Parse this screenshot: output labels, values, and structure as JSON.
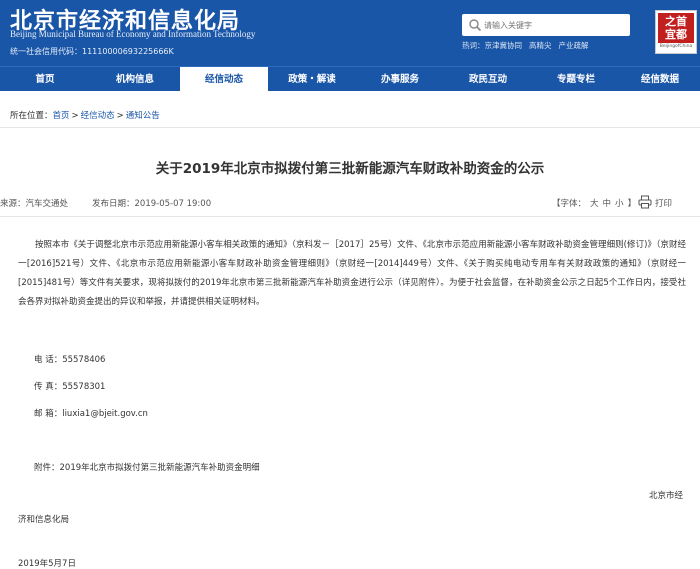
{
  "header": {
    "logo_cn": "北京市经济和信息化局",
    "logo_en": "Beijing  Municipal Bureau of Economy and Information Technology",
    "credit_code": "统一社会信用代码：11110000693225666K",
    "search_placeholder": "请输入关键字",
    "hot_label": "热词：",
    "hot_words": [
      "京津冀协同",
      "高精尖",
      "产业疏解"
    ],
    "seal_text": "之首\n宜都",
    "seal_caption": "BeijingofChina"
  },
  "nav": {
    "items": [
      {
        "label": "首页",
        "active": false
      },
      {
        "label": "机构信息",
        "active": false
      },
      {
        "label": "经信动态",
        "active": true
      },
      {
        "label": "政策・解读",
        "active": false
      },
      {
        "label": "办事服务",
        "active": false
      },
      {
        "label": "政民互动",
        "active": false
      },
      {
        "label": "专题专栏",
        "active": false
      },
      {
        "label": "经信数据",
        "active": false
      }
    ]
  },
  "breadcrumb": {
    "prefix": "所在位置：",
    "links": [
      "首页",
      "经信动态",
      "通知公告"
    ],
    "sep": ">"
  },
  "article": {
    "title": "关于2019年北京市拟拨付第三批新能源汽车财政补助资金的公示",
    "source": "来源：汽车交通处",
    "date": "发布日期：2019-05-07 19:00",
    "font_label": "【字体：",
    "font_sizes": [
      "大",
      "中",
      "小"
    ],
    "font_close": "】",
    "print_label": "打印",
    "body": "按照本市《关于调整北京市示范应用新能源小客车相关政策的通知》（京科发－［2017］25号）文件、《北京市示范应用新能源小客车财政补助资金管理细则(修订)》（京财经一[2016]521号）文件、《北京市示范应用新能源小客车财政补助资金管理细则》（京财经一[2014]449号）文件、《关于购买纯电动专用车有关财政政策的通知》（京财经一[2015]481号）等文件有关要求，现将拟拨付的2019年北京市第三批新能源汽车补助资金进行公示（详见附件）。为便于社会监督，在补助资金公示之日起5个工作日内，接受社会各界对拟补助资金提出的异议和举报，并请提供相关证明材料。",
    "phone": "电   话：55578406",
    "fax": "传   真：55578301",
    "email": "邮   箱：liuxia1@bjeit.gov.cn",
    "attachment": "附件：2019年北京市拟拨付第三批新能源汽车补助资金明细",
    "signer_part1": "北京市经",
    "signer_part2": "济和信息化局",
    "sign_date": "2019年5月7日"
  }
}
